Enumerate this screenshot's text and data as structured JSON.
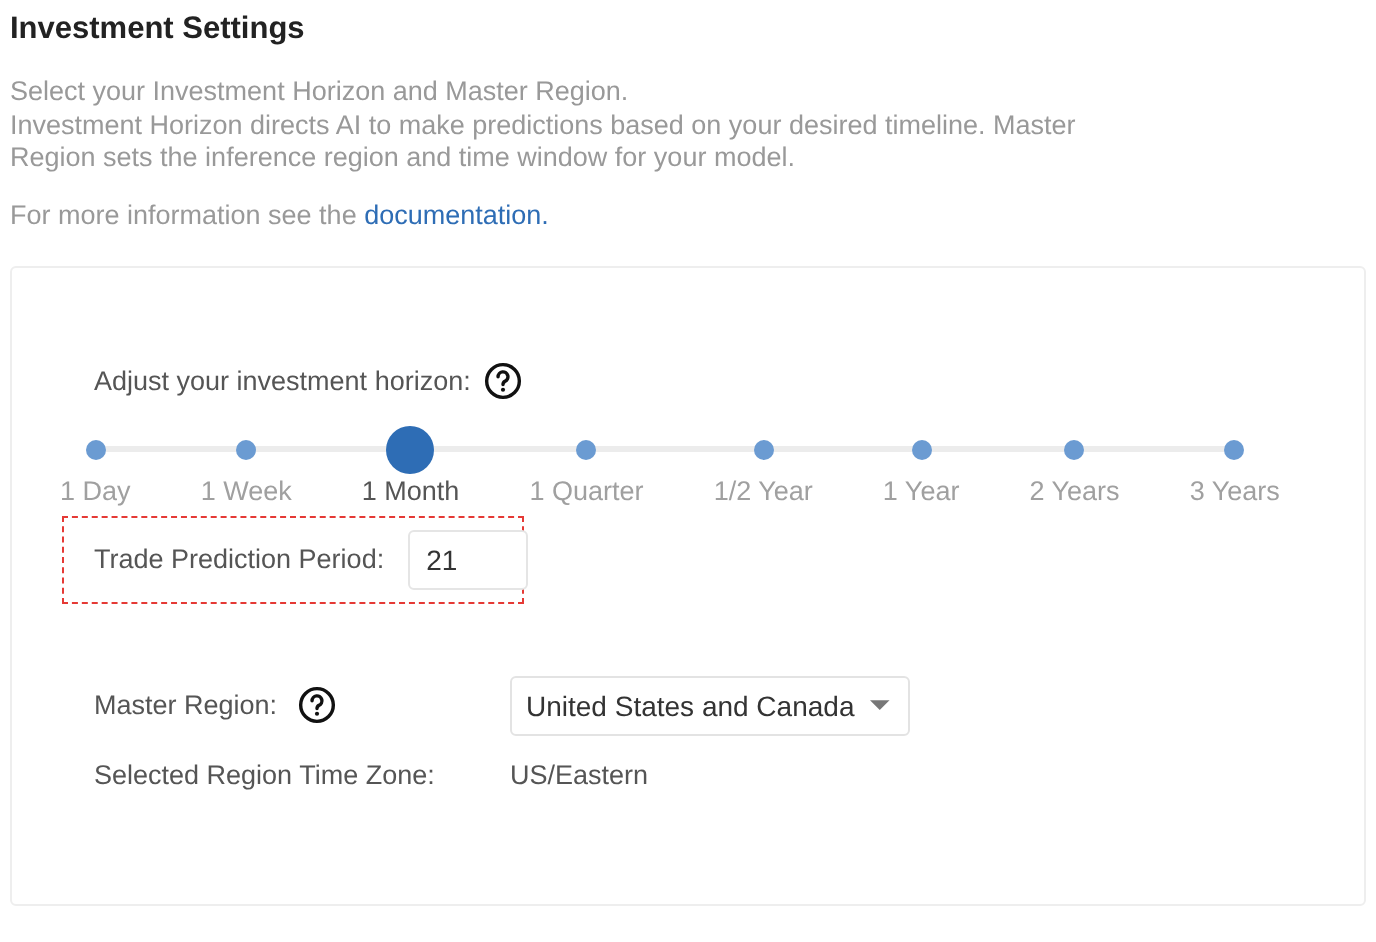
{
  "title": "Investment Settings",
  "description": [
    "Select your Investment Horizon and Master Region.",
    "Investment Horizon directs AI to make predictions based on your desired timeline. Master Region sets the inference region and time window for your model."
  ],
  "more_info": {
    "text": "For more information see the ",
    "link": "documentation."
  },
  "horizon": {
    "label": "Adjust your investment horizon:",
    "stops": [
      {
        "label": "1 Day",
        "selected": false
      },
      {
        "label": "1 Week",
        "selected": false
      },
      {
        "label": "1 Month",
        "selected": true
      },
      {
        "label": "1 Quarter",
        "selected": false
      },
      {
        "label": "1/2 Year",
        "selected": false
      },
      {
        "label": "1 Year",
        "selected": false
      },
      {
        "label": "2 Years",
        "selected": false
      },
      {
        "label": "3 Years",
        "selected": false
      }
    ]
  },
  "trade_prediction_period": {
    "label": "Trade Prediction Period:",
    "value": "21"
  },
  "master_region": {
    "label": "Master Region:",
    "value": "United States and Canada"
  },
  "time_zone": {
    "label": "Selected Region Time Zone:",
    "value": "US/Eastern"
  }
}
